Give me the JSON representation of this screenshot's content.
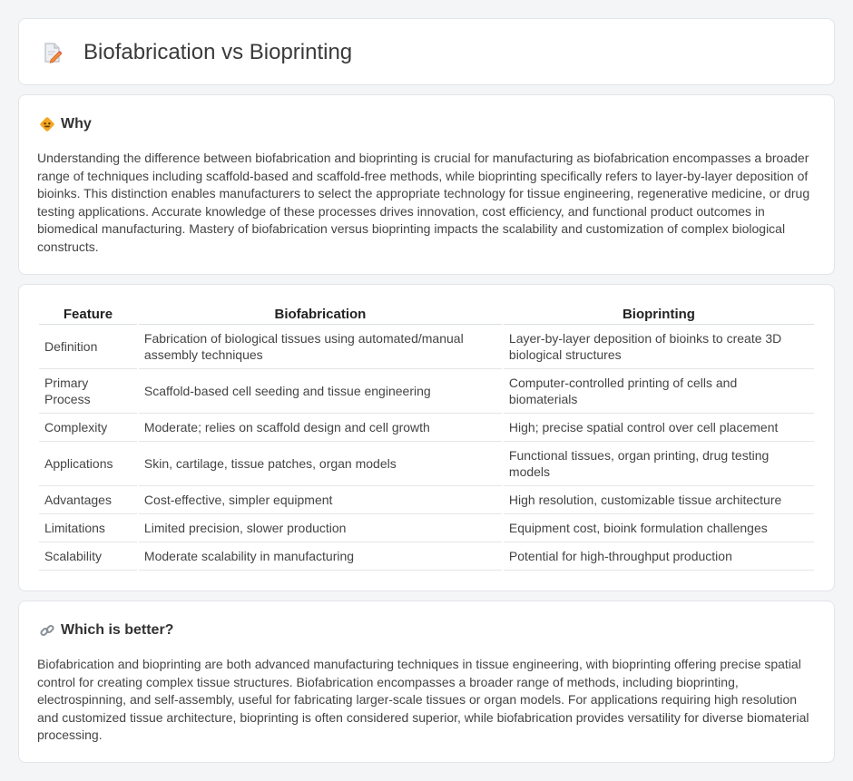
{
  "page": {
    "title": "Biofabrication vs Bioprinting",
    "title_icon": "document-pencil-icon"
  },
  "why": {
    "heading": "Why",
    "icon": "warning-diamond-icon",
    "text": "Understanding the difference between biofabrication and bioprinting is crucial for manufacturing as biofabrication encompasses a broader range of techniques including scaffold-based and scaffold-free methods, while bioprinting specifically refers to layer-by-layer deposition of bioinks. This distinction enables manufacturers to select the appropriate technology for tissue engineering, regenerative medicine, or drug testing applications. Accurate knowledge of these processes drives innovation, cost efficiency, and functional product outcomes in biomedical manufacturing. Mastery of biofabrication versus bioprinting impacts the scalability and customization of complex biological constructs."
  },
  "comparison": {
    "headers": [
      "Feature",
      "Biofabrication",
      "Bioprinting"
    ],
    "rows": [
      [
        "Definition",
        "Fabrication of biological tissues using automated/manual assembly techniques",
        "Layer-by-layer deposition of bioinks to create 3D biological structures"
      ],
      [
        "Primary Process",
        "Scaffold-based cell seeding and tissue engineering",
        "Computer-controlled printing of cells and biomaterials"
      ],
      [
        "Complexity",
        "Moderate; relies on scaffold design and cell growth",
        "High; precise spatial control over cell placement"
      ],
      [
        "Applications",
        "Skin, cartilage, tissue patches, organ models",
        "Functional tissues, organ printing, drug testing models"
      ],
      [
        "Advantages",
        "Cost-effective, simpler equipment",
        "High resolution, customizable tissue architecture"
      ],
      [
        "Limitations",
        "Limited precision, slower production",
        "Equipment cost, bioink formulation challenges"
      ],
      [
        "Scalability",
        "Moderate scalability in manufacturing",
        "Potential for high-throughput production"
      ]
    ]
  },
  "better": {
    "heading": "Which is better?",
    "icon": "link-icon",
    "text": "Biofabrication and bioprinting are both advanced manufacturing techniques in tissue engineering, with bioprinting offering precise spatial control for creating complex tissue structures. Biofabrication encompasses a broader range of methods, including bioprinting, electrospinning, and self-assembly, useful for fabricating larger-scale tissues or organ models. For applications requiring high resolution and customized tissue architecture, bioprinting is often considered superior, while biofabrication provides versatility for diverse biomaterial processing."
  },
  "colors": {
    "background": "#f4f5f7",
    "card": "#ffffff",
    "border": "#e2e4e8",
    "accent_orange": "#f0a030"
  }
}
